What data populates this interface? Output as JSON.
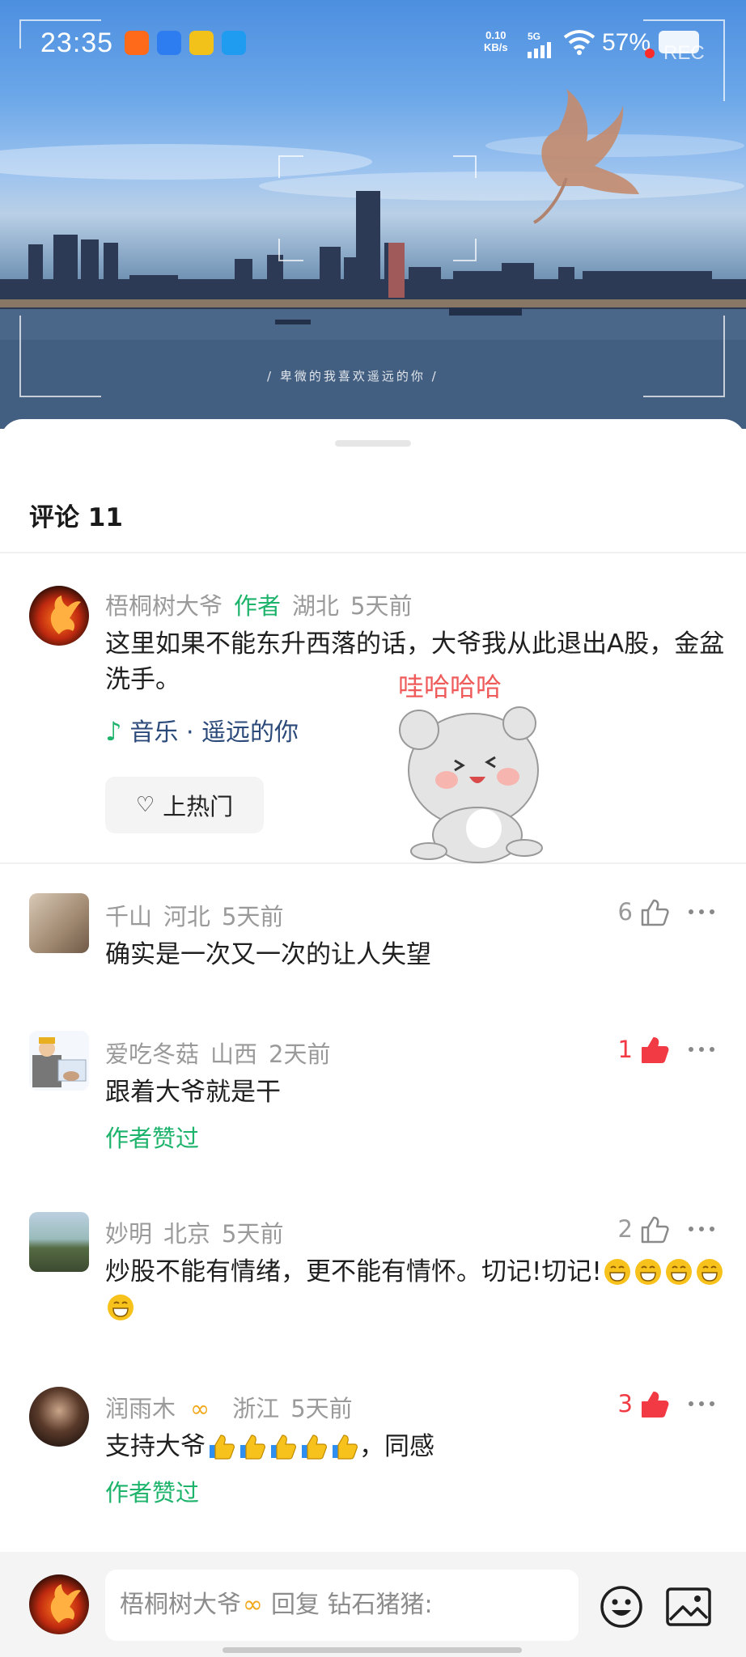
{
  "status_bar": {
    "time": "23:35",
    "net_speed_value": "0.10",
    "net_speed_unit": "KB/s",
    "network": "5G",
    "battery": "57%",
    "rec": "REC"
  },
  "video": {
    "caption": "/ 卑微的我喜欢遥远的你 /"
  },
  "sticker": {
    "text": "哇哈哈哈"
  },
  "header": {
    "title": "评论 11"
  },
  "pinned_comment": {
    "user": "梧桐树大爷",
    "tag": "作者",
    "location": "湖北",
    "time": "5天前",
    "text": "这里如果不能东升西落的话，大爷我从此退出A股，金盆洗手。",
    "music": "音乐 · 遥远的你",
    "hot_button": "上热门"
  },
  "comments": [
    {
      "user": "千山",
      "location": "河北",
      "time": "5天前",
      "text": "确实是一次又一次的让人失望",
      "likes": "6",
      "liked": false,
      "author_liked": ""
    },
    {
      "user": "爱吃冬菇",
      "location": "山西",
      "time": "2天前",
      "text": "跟着大爷就是干",
      "likes": "1",
      "liked": true,
      "author_liked": "作者赞过"
    },
    {
      "user": "妙明",
      "location": "北京",
      "time": "5天前",
      "text": "炒股不能有情绪，更不能有情怀。切记!切记!",
      "likes": "2",
      "liked": false,
      "author_liked": ""
    },
    {
      "user": "润雨木",
      "location": "浙江",
      "time": "5天前",
      "text_before": "支持大爷",
      "text_after": "，同感",
      "likes": "3",
      "liked": true,
      "author_liked": "作者赞过"
    }
  ],
  "reply_bar": {
    "placeholder_name": "梧桐树大爷",
    "placeholder_action": "回复 钻石猪猪:"
  },
  "colors": {
    "author_green": "#1db36b",
    "like_red": "#f23a45",
    "meta_gray": "#9a9a9a"
  },
  "icons": [
    "music-note-icon",
    "heart-icon",
    "thumb-up-icon",
    "more-icon",
    "emoji-icon",
    "image-icon",
    "grin-emoji",
    "thumbs-up-emoji"
  ]
}
